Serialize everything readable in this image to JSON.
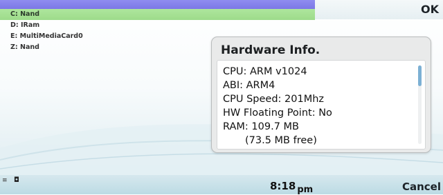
{
  "softkeys": {
    "ok_label": "OK",
    "cancel_label": "Cancel"
  },
  "drives": [
    {
      "label": "C: Nand",
      "selected": true
    },
    {
      "label": "D: IRam",
      "selected": false
    },
    {
      "label": "E: MultiMediaCard0",
      "selected": false
    },
    {
      "label": "Z: Nand",
      "selected": false
    }
  ],
  "dialog": {
    "title": "Hardware Info.",
    "lines": [
      "CPU: ARM v1024",
      "ABI: ARM4",
      "CPU Speed: 201Mhz",
      "HW Floating Point: No",
      "RAM: 109.7 MB",
      "(73.5 MB free)"
    ],
    "scroll_position": 0.0
  },
  "status": {
    "time": "8:18",
    "ampm": "pm",
    "left_glyph": "≡",
    "left_glyph2": "◘"
  },
  "colors": {
    "selection": "#9ddb8a",
    "title_bar": "#7c78e6",
    "scroll_thumb": "#7cb0d4"
  }
}
